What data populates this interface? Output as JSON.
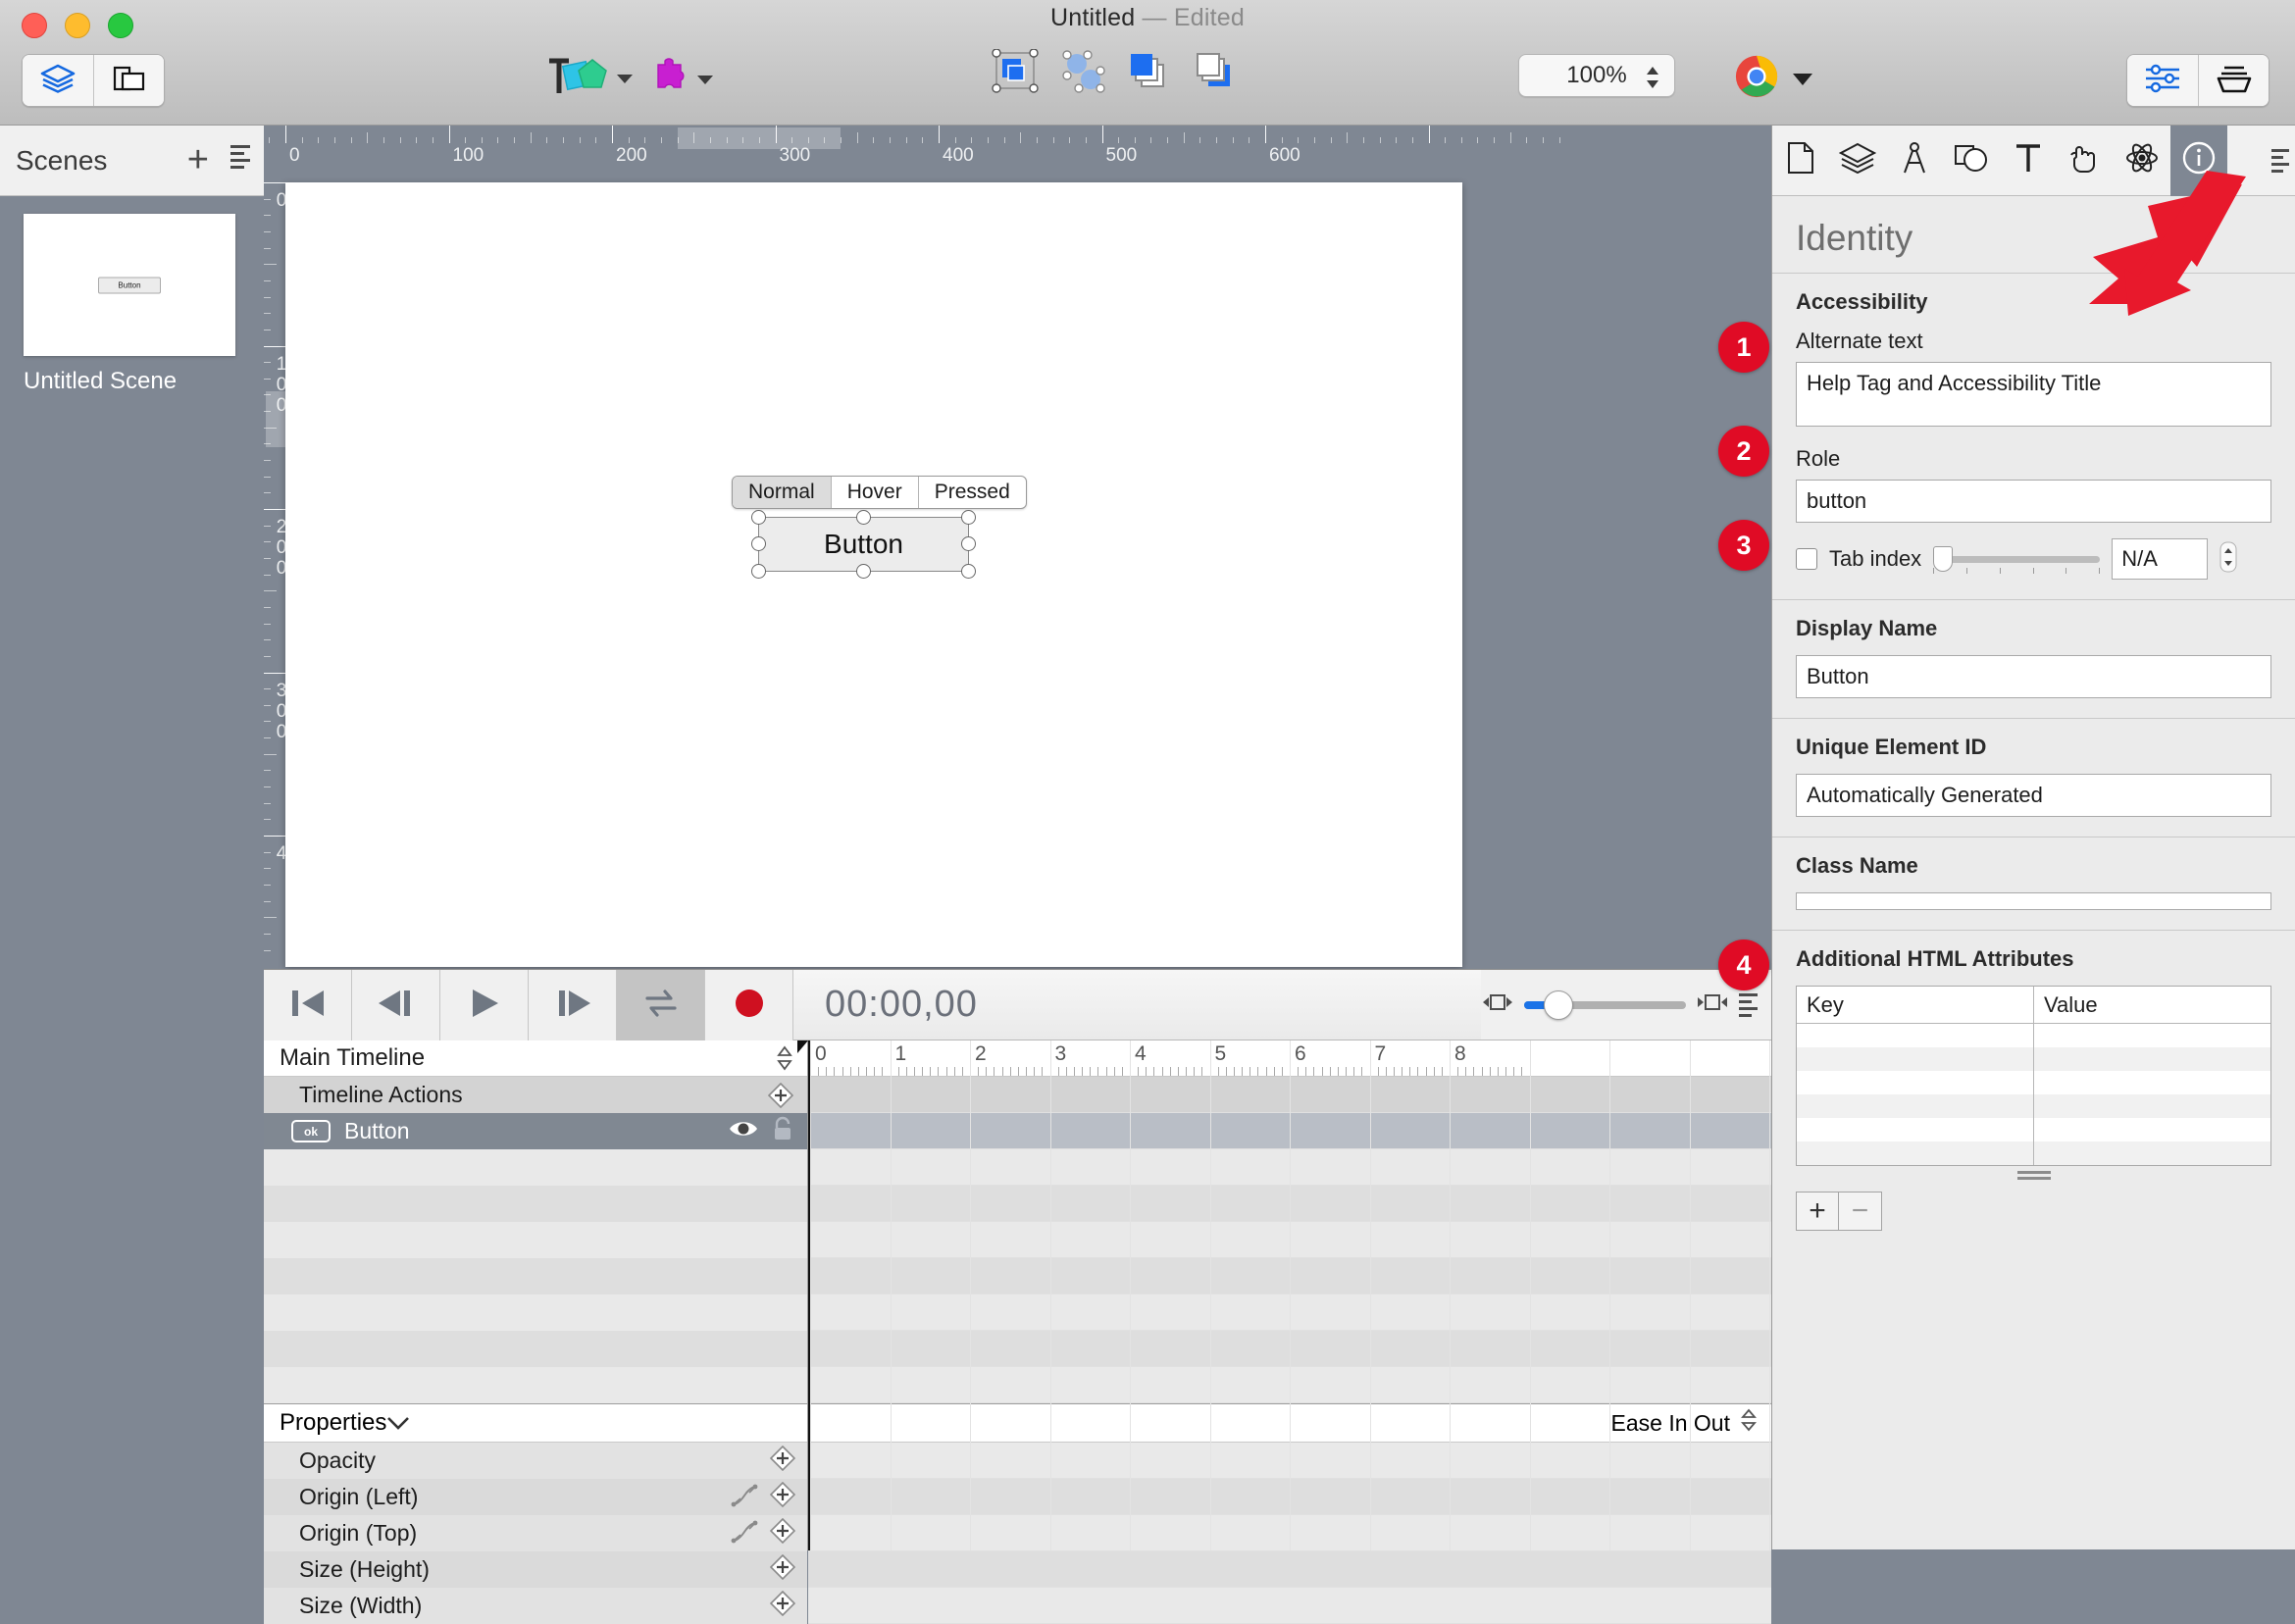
{
  "window": {
    "title": "Untitled",
    "separator": "—",
    "state": "Edited"
  },
  "toolbar": {
    "left_segments": [
      {
        "name": "layers-view",
        "icon": "layers-icon"
      },
      {
        "name": "resources-view",
        "icon": "documents-icon"
      }
    ],
    "elements_menu": {
      "label": "Elements",
      "icon": "text-shapes-icon"
    },
    "widgets_menu": {
      "label": "Widgets",
      "icon": "puzzle-piece-icon"
    },
    "align_tools": [
      {
        "name": "selection-tool",
        "icon": "selection-box-icon"
      },
      {
        "name": "group-tool",
        "icon": "path-nodes-icon"
      },
      {
        "name": "bring-front",
        "icon": "bring-front-icon"
      },
      {
        "name": "send-back",
        "icon": "send-back-icon"
      }
    ],
    "zoom": {
      "value": "100%"
    },
    "preview": {
      "label": "Preview",
      "icon": "chrome-icon"
    },
    "right_segments": [
      {
        "name": "inspector-toggle",
        "icon": "sliders-icon"
      },
      {
        "name": "library-toggle",
        "icon": "tray-icon"
      }
    ]
  },
  "sidebar": {
    "title": "Scenes",
    "add_label": "+",
    "scene": {
      "name": "Untitled Scene",
      "thumb_button_label": "Button"
    }
  },
  "canvas": {
    "ruler_h_labels": [
      "0",
      "100",
      "200",
      "300",
      "400",
      "500",
      "600"
    ],
    "ruler_v_labels": [
      "0",
      "100",
      "200",
      "300",
      "4"
    ],
    "states": [
      {
        "label": "Normal",
        "selected": true
      },
      {
        "label": "Hover",
        "selected": false
      },
      {
        "label": "Pressed",
        "selected": false
      }
    ],
    "selected_element": {
      "label": "Button"
    }
  },
  "transport": {
    "buttons": [
      {
        "name": "go-to-start-button",
        "icon": "skip-start-icon",
        "active": false
      },
      {
        "name": "step-back-button",
        "icon": "step-back-icon",
        "active": false
      },
      {
        "name": "play-button",
        "icon": "play-icon",
        "active": false
      },
      {
        "name": "step-forward-button",
        "icon": "step-forward-icon",
        "active": false
      },
      {
        "name": "loop-button",
        "icon": "loop-icon",
        "active": true
      },
      {
        "name": "record-button",
        "icon": "record-icon",
        "active": false
      }
    ],
    "timecode": "00:00,00"
  },
  "timeline": {
    "name": "Main Timeline",
    "rows": [
      {
        "label": "Timeline Actions",
        "type": "actions"
      },
      {
        "label": "Button",
        "type": "element",
        "badge": "ok",
        "selected": true
      }
    ],
    "ruler_labels": [
      "0",
      "1",
      "2",
      "3",
      "4",
      "5",
      "6",
      "7",
      "8"
    ],
    "properties": {
      "title": "Properties",
      "easing": "Ease In Out",
      "items": [
        {
          "label": "Opacity",
          "has_curve": false
        },
        {
          "label": "Origin (Left)",
          "has_curve": true
        },
        {
          "label": "Origin (Top)",
          "has_curve": true
        },
        {
          "label": "Size (Height)",
          "has_curve": false
        },
        {
          "label": "Size (Width)",
          "has_curve": false
        }
      ]
    }
  },
  "inspector": {
    "tabs": [
      {
        "name": "document-tab",
        "icon": "document-icon",
        "selected": false
      },
      {
        "name": "scene-tab",
        "icon": "layers-icon",
        "selected": false
      },
      {
        "name": "metrics-tab",
        "icon": "compass-icon",
        "selected": false
      },
      {
        "name": "element-tab",
        "icon": "shapes-icon",
        "selected": false
      },
      {
        "name": "text-tab",
        "icon": "text-icon",
        "selected": false
      },
      {
        "name": "actions-tab",
        "icon": "hand-icon",
        "selected": false
      },
      {
        "name": "physics-tab",
        "icon": "atom-icon",
        "selected": false
      },
      {
        "name": "identity-tab",
        "icon": "info-icon",
        "selected": true
      }
    ],
    "title": "Identity",
    "accessibility": {
      "section_title": "Accessibility",
      "alternate_text_label": "Alternate text",
      "alternate_text_value": "Help Tag and Accessibility Title",
      "role_label": "Role",
      "role_value": "button",
      "tab_index_label": "Tab index",
      "tab_index_value": "N/A",
      "tab_index_checked": false
    },
    "display_name": {
      "label": "Display Name",
      "value": "Button"
    },
    "unique_id": {
      "label": "Unique Element ID",
      "value": "Automatically Generated"
    },
    "class_name": {
      "label": "Class Name",
      "value": ""
    },
    "html_attributes": {
      "label": "Additional HTML Attributes",
      "columns": [
        "Key",
        "Value"
      ],
      "rows": [],
      "add_label": "+",
      "remove_label": "−"
    }
  },
  "callouts": [
    {
      "number": "1",
      "target": "alternate-text-field"
    },
    {
      "number": "2",
      "target": "role-field"
    },
    {
      "number": "3",
      "target": "tab-index-row"
    },
    {
      "number": "4",
      "target": "additional-html-attributes"
    }
  ],
  "colors": {
    "accent_red": "#e00b25",
    "accent_blue": "#1a73e8",
    "chrome_gray": "#7f8793"
  }
}
